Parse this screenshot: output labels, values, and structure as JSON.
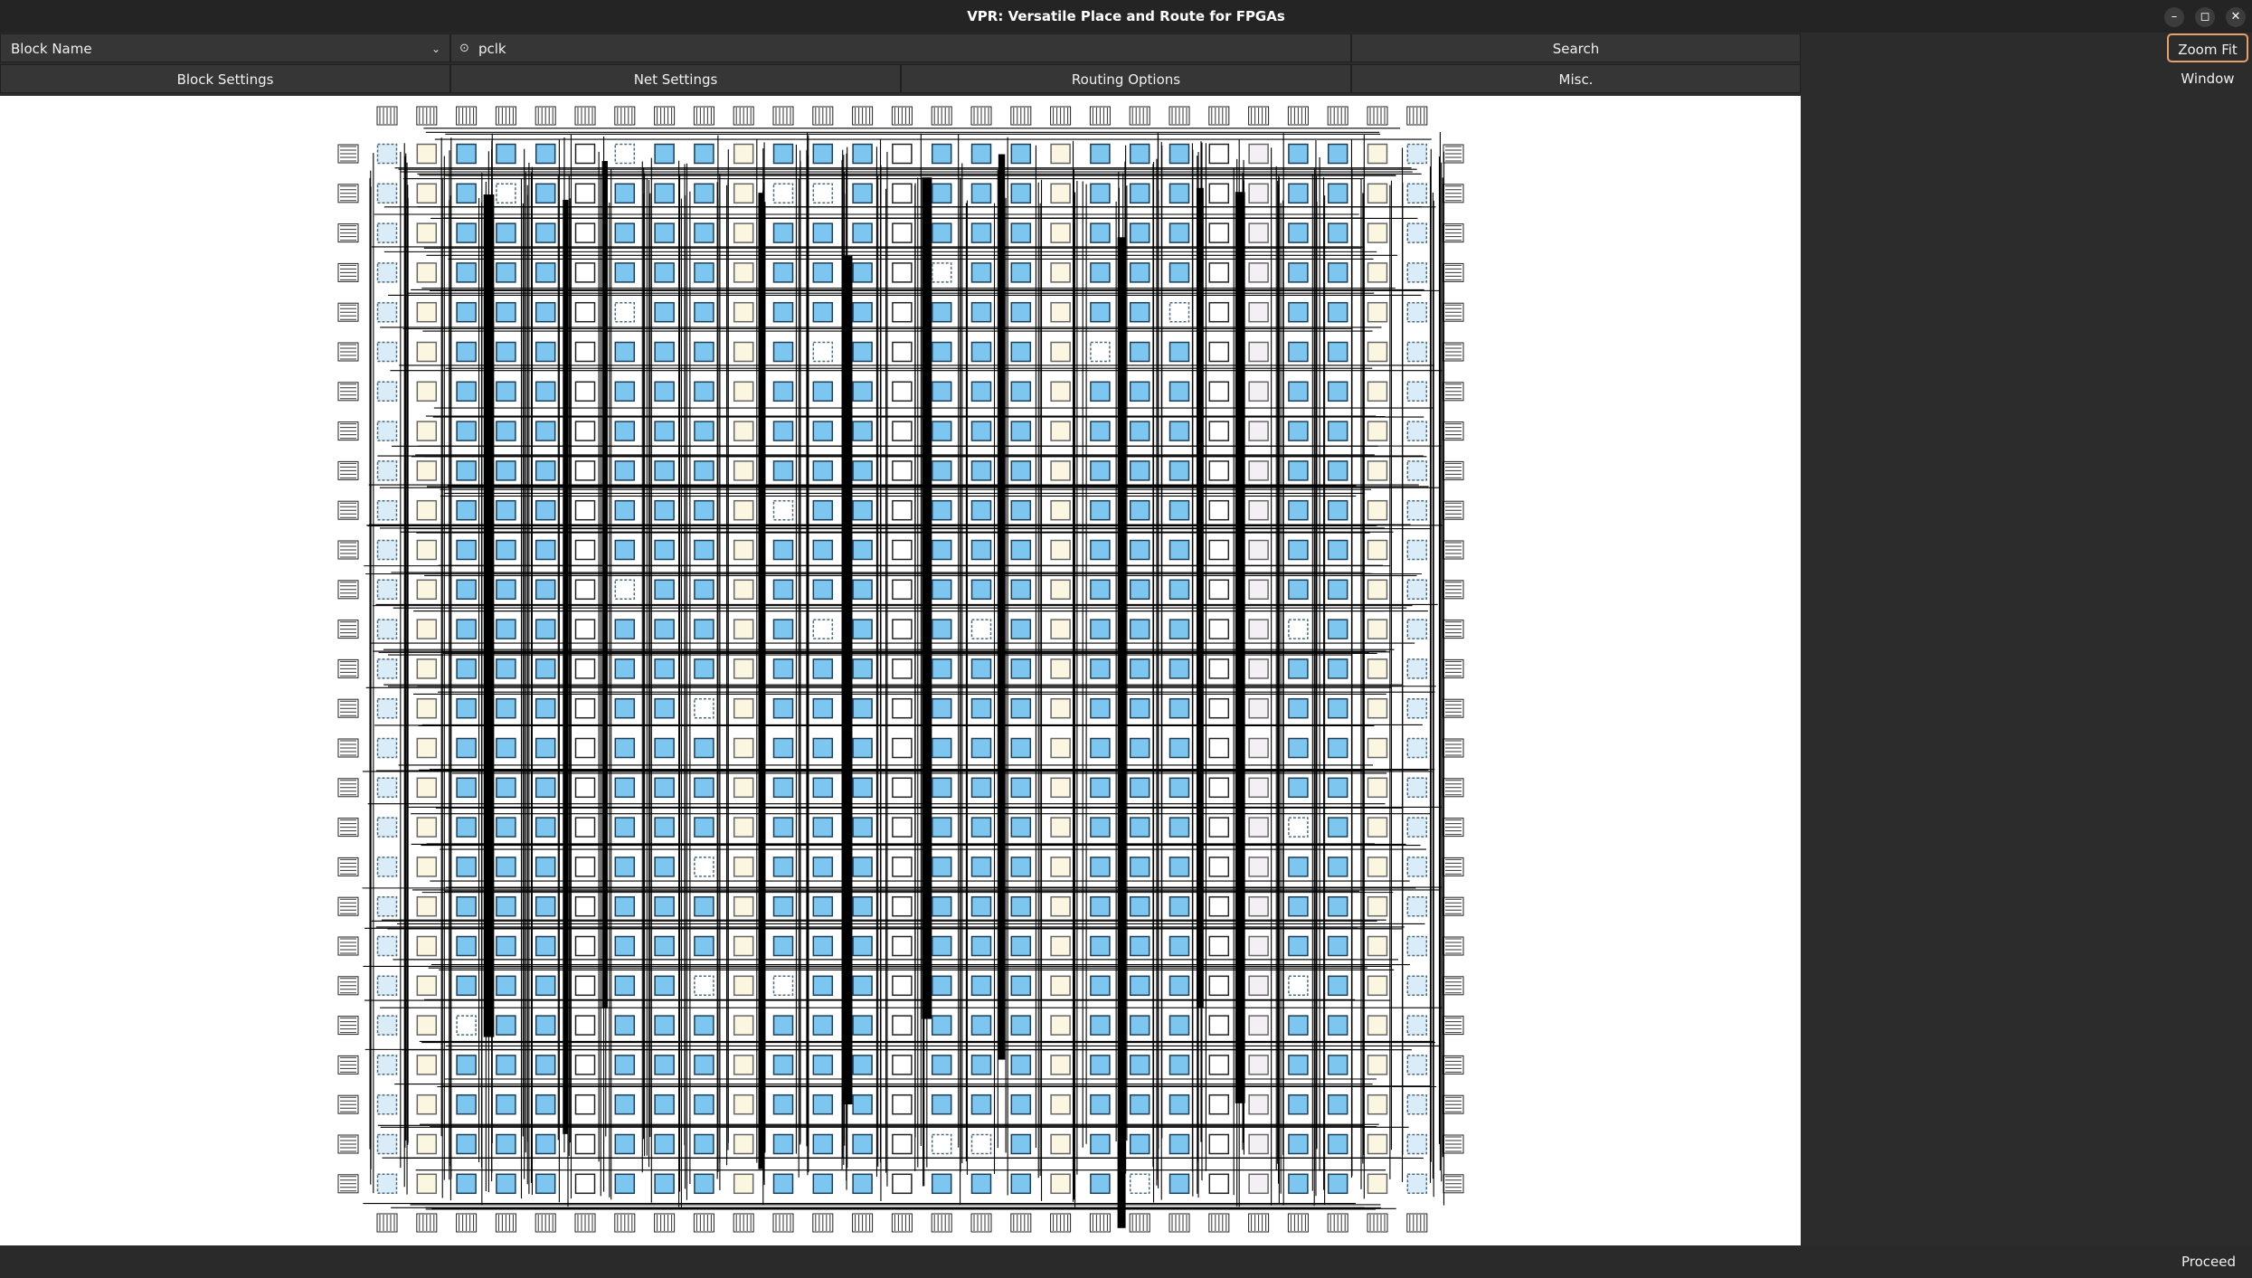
{
  "window": {
    "title": "VPR: Versatile Place and Route for FPGAs",
    "controls": [
      "–",
      "◻",
      "✕"
    ]
  },
  "toolbar": {
    "search_by": "Block Name",
    "search_value": "pclk",
    "search_label": "Search",
    "tabs": [
      "Block Settings",
      "Net Settings",
      "Routing Options",
      "Misc."
    ]
  },
  "side": {
    "zoom_fit_label": "Zoom Fit",
    "window_label": "Window"
  },
  "status": {
    "proceed_label": "Proceed"
  },
  "colors": {
    "accent": "#e9a06a",
    "clb": "#7cc6f0",
    "io": "#d9ecf8",
    "memory": "#fbf6e0",
    "dsp": "#f4eef5",
    "routing": "#000000"
  }
}
